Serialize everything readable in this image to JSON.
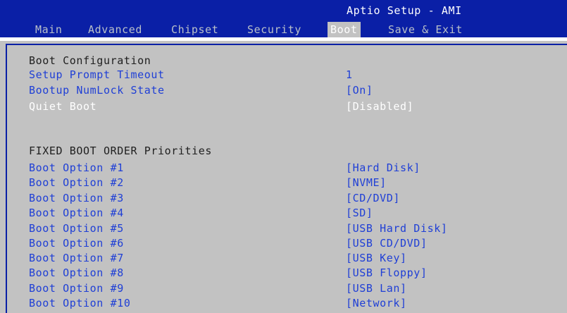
{
  "header": {
    "title": "Aptio Setup - AMI",
    "tabs": [
      {
        "label": "Main"
      },
      {
        "label": "Advanced"
      },
      {
        "label": "Chipset"
      },
      {
        "label": "Security"
      },
      {
        "label": "Boot"
      },
      {
        "label": "Save & Exit"
      }
    ],
    "active_tab": "Boot"
  },
  "boot_config": {
    "section_title": "Boot Configuration",
    "setup_prompt_timeout": {
      "label": "Setup Prompt Timeout",
      "value": "1"
    },
    "numlock_state": {
      "label": "Bootup NumLock State",
      "value": "[On]"
    },
    "quiet_boot": {
      "label": "Quiet Boot",
      "value": "[Disabled]"
    }
  },
  "boot_order": {
    "section_title": "FIXED BOOT ORDER Priorities",
    "options": [
      {
        "label": "Boot Option #1",
        "value": "[Hard Disk]"
      },
      {
        "label": "Boot Option #2",
        "value": "[NVME]"
      },
      {
        "label": "Boot Option #3",
        "value": "[CD/DVD]"
      },
      {
        "label": "Boot Option #4",
        "value": "[SD]"
      },
      {
        "label": "Boot Option #5",
        "value": "[USB Hard Disk]"
      },
      {
        "label": "Boot Option #6",
        "value": "[USB CD/DVD]"
      },
      {
        "label": "Boot Option #7",
        "value": "[USB Key]"
      },
      {
        "label": "Boot Option #8",
        "value": "[USB Floppy]"
      },
      {
        "label": "Boot Option #9",
        "value": "[USB Lan]"
      },
      {
        "label": "Boot Option #10",
        "value": "[Network]"
      }
    ]
  },
  "colors": {
    "header_blue": "#0a1fa6",
    "panel_gray": "#c2c2c2",
    "item_blue": "#1f3fd6",
    "tab_text": "#b9c0c8"
  }
}
